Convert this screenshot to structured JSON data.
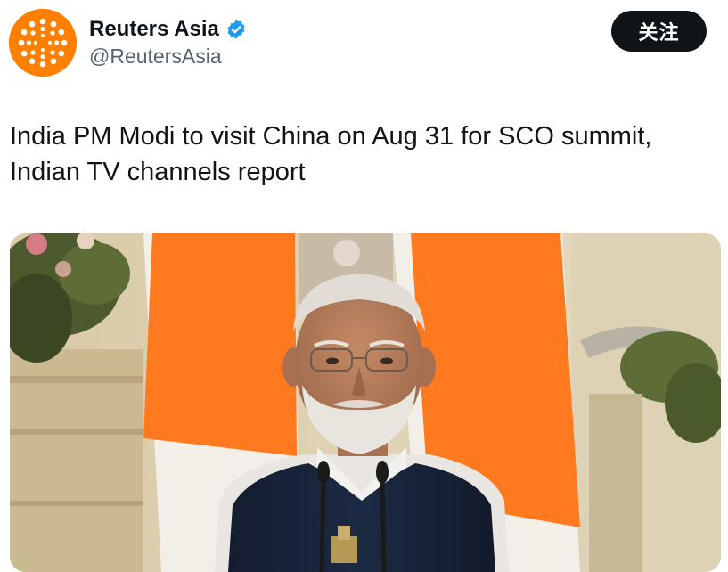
{
  "account": {
    "display_name": "Reuters Asia",
    "handle": "@ReutersAsia",
    "verified": true,
    "verified_icon": "verified-badge-icon",
    "avatar_icon": "reuters-logo-icon",
    "avatar_color": "#ff8000"
  },
  "actions": {
    "follow_label": "关注"
  },
  "tweet": {
    "line1": "India PM Modi to visit China on Aug 31 for SCO summit,",
    "line2": "Indian TV channels report"
  },
  "colors": {
    "flag_saffron": "#ff7a1f",
    "verified_blue": "#1d9bf0",
    "button_black": "#0f1419"
  }
}
